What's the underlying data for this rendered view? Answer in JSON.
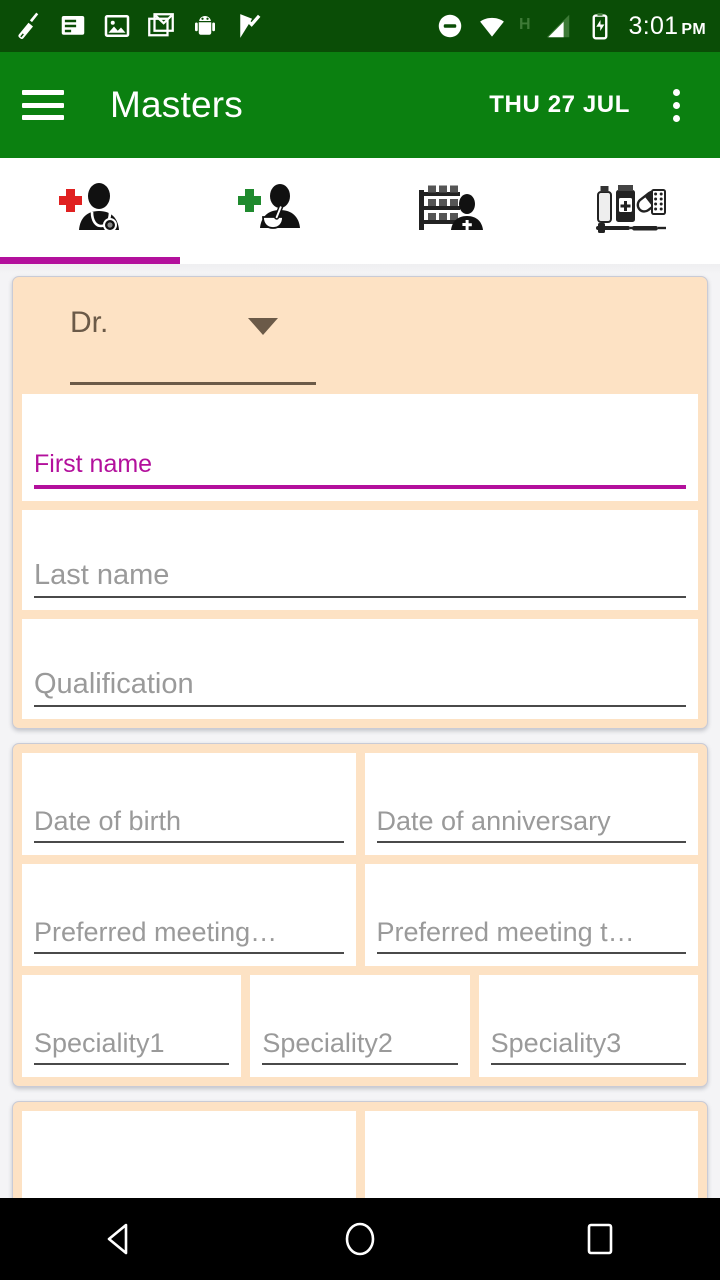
{
  "status_bar": {
    "time": "3:01",
    "ampm": "PM",
    "network_type": "H",
    "left_icons": [
      "broom-clean-icon",
      "document-icon",
      "image-icon",
      "gmail-icon",
      "android-robot-icon",
      "check-flag-icon"
    ],
    "right_icons": [
      "do-not-disturb-icon",
      "wifi-icon",
      "cellular-signal-icon",
      "battery-charging-icon"
    ],
    "background_color": "#0A4D06"
  },
  "app_bar": {
    "menu_icon": "hamburger-menu-icon",
    "title": "Masters",
    "date": "THU 27 JUL",
    "overflow_icon": "more-vertical-icon",
    "background_color": "#0B8010"
  },
  "tabs": {
    "active_index": 0,
    "indicator_color": "#B3109C",
    "items": [
      {
        "name": "doctor-tab",
        "icon": "doctor-with-stethoscope-icon",
        "accent_color": "#E02020"
      },
      {
        "name": "chemist-tab",
        "icon": "chemist-with-mortar-icon",
        "accent_color": "#1F8A2E"
      },
      {
        "name": "stockist-tab",
        "icon": "stockist-shelf-person-icon",
        "accent_color": "#1A1A1A"
      },
      {
        "name": "products-tab",
        "icon": "medicine-products-icon",
        "accent_color": "#1A1A1A"
      }
    ]
  },
  "theme": {
    "card_background": "#FDE2C4",
    "card_border": "#C9CBD6",
    "field_background": "#FFFFFF",
    "placeholder_color": "#9A9A9A",
    "focus_color": "#B3109C",
    "page_background": "#F4F4F6"
  },
  "form": {
    "cards": [
      {
        "name": "name-card",
        "title_dropdown": {
          "value": "Dr.",
          "icon": "chevron-down-icon"
        },
        "fields": [
          {
            "name": "first-name-field",
            "placeholder": "First name",
            "value": "",
            "focused": true
          },
          {
            "name": "last-name-field",
            "placeholder": "Last name",
            "value": "",
            "focused": false
          },
          {
            "name": "qualification-field",
            "placeholder": "Qualification",
            "value": "",
            "focused": false
          }
        ]
      },
      {
        "name": "details-card",
        "rows": [
          [
            {
              "name": "date-of-birth-field",
              "placeholder": "Date of birth",
              "value": ""
            },
            {
              "name": "date-of-anniversary-field",
              "placeholder": "Date of anniversary",
              "value": ""
            }
          ],
          [
            {
              "name": "preferred-meeting-day-field",
              "placeholder": "Preferred meeting…",
              "value": ""
            },
            {
              "name": "preferred-meeting-time-field",
              "placeholder": "Preferred meeting t…",
              "value": ""
            }
          ],
          [
            {
              "name": "speciality1-field",
              "placeholder": "Speciality1",
              "value": ""
            },
            {
              "name": "speciality2-field",
              "placeholder": "Speciality2",
              "value": ""
            },
            {
              "name": "speciality3-field",
              "placeholder": "Speciality3",
              "value": ""
            }
          ]
        ]
      },
      {
        "name": "address-card-partial",
        "rows": [
          [
            {
              "name": "partial-field-left",
              "placeholder": "",
              "value": ""
            },
            {
              "name": "partial-field-right",
              "placeholder": "",
              "value": ""
            }
          ]
        ]
      }
    ]
  },
  "nav_bar": {
    "back_icon": "back-triangle-icon",
    "home_icon": "home-circle-icon",
    "recents_icon": "recents-square-icon",
    "background_color": "#000000"
  }
}
